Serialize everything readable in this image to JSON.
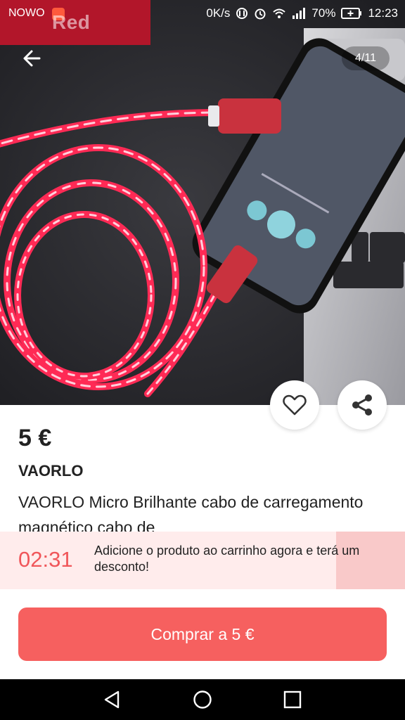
{
  "status_bar": {
    "carrier": "NOWO",
    "app_badge": "Red",
    "network_speed": "0K/s",
    "battery": "70%",
    "time": "12:23"
  },
  "gallery": {
    "counter": "4/11"
  },
  "product": {
    "price": "5 €",
    "brand": "VAORLO",
    "title": "VAORLO Micro Brilhante cabo de carregamento magnético cabo de"
  },
  "promo": {
    "timer": "02:31",
    "message": "Adicione o produto ao carrinho agora e terá um desconto!"
  },
  "buy_button": {
    "label": "Comprar a 5 €"
  },
  "colors": {
    "accent": "#f6605f",
    "promo_bg": "#ffecec",
    "status_red": "#b2162a"
  }
}
